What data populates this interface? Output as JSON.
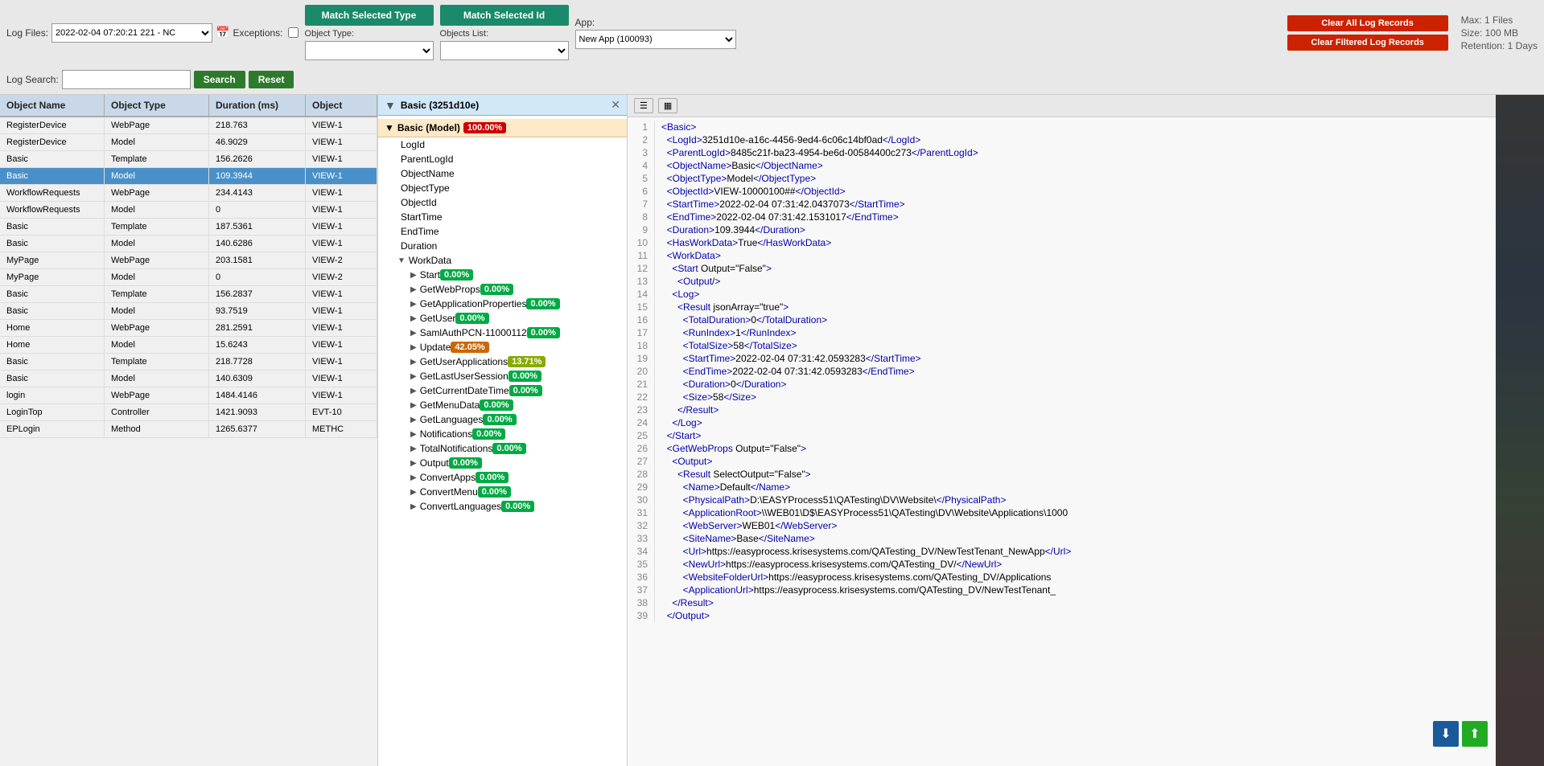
{
  "header": {
    "log_files_label": "Log Files:",
    "log_files_value": "2022-02-04 07:20:21 221 - NC",
    "exceptions_label": "Exceptions:",
    "log_search_label": "Log Search:",
    "search_placeholder": "",
    "search_btn": "Search",
    "reset_btn": "Reset",
    "match_type_btn": "Match Selected Type",
    "match_id_btn": "Match Selected Id",
    "object_type_label": "Object Type:",
    "objects_list_label": "Objects List:",
    "app_label": "App:",
    "app_value": "New App (100093)",
    "clear_all_btn": "Clear All Log Records",
    "clear_filtered_btn": "Clear Filtered Log Records",
    "meta_max": "Max: 1 Files",
    "meta_size": "Size: 100 MB",
    "meta_retention": "Retention: 1 Days"
  },
  "table": {
    "columns": [
      "Object Name",
      "Object Type",
      "Duration (ms)",
      "Object"
    ],
    "rows": [
      {
        "name": "RegisterDevice",
        "type": "WebPage",
        "duration": "218.763",
        "object": "VIEW-1"
      },
      {
        "name": "RegisterDevice",
        "type": "Model",
        "duration": "46.9029",
        "object": "VIEW-1"
      },
      {
        "name": "Basic",
        "type": "Template",
        "duration": "156.2626",
        "object": "VIEW-1"
      },
      {
        "name": "Basic",
        "type": "Model",
        "duration": "109.3944",
        "object": "VIEW-1",
        "selected": true
      },
      {
        "name": "WorkflowRequests",
        "type": "WebPage",
        "duration": "234.4143",
        "object": "VIEW-1"
      },
      {
        "name": "WorkflowRequests",
        "type": "Model",
        "duration": "0",
        "object": "VIEW-1"
      },
      {
        "name": "Basic",
        "type": "Template",
        "duration": "187.5361",
        "object": "VIEW-1"
      },
      {
        "name": "Basic",
        "type": "Model",
        "duration": "140.6286",
        "object": "VIEW-1"
      },
      {
        "name": "MyPage",
        "type": "WebPage",
        "duration": "203.1581",
        "object": "VIEW-2"
      },
      {
        "name": "MyPage",
        "type": "Model",
        "duration": "0",
        "object": "VIEW-2"
      },
      {
        "name": "Basic",
        "type": "Template",
        "duration": "156.2837",
        "object": "VIEW-1"
      },
      {
        "name": "Basic",
        "type": "Model",
        "duration": "93.7519",
        "object": "VIEW-1"
      },
      {
        "name": "Home",
        "type": "WebPage",
        "duration": "281.2591",
        "object": "VIEW-1"
      },
      {
        "name": "Home",
        "type": "Model",
        "duration": "15.6243",
        "object": "VIEW-1"
      },
      {
        "name": "Basic",
        "type": "Template",
        "duration": "218.7728",
        "object": "VIEW-1"
      },
      {
        "name": "Basic",
        "type": "Model",
        "duration": "140.6309",
        "object": "VIEW-1"
      },
      {
        "name": "login",
        "type": "WebPage",
        "duration": "1484.4146",
        "object": "VIEW-1"
      },
      {
        "name": "LoginTop",
        "type": "Controller",
        "duration": "1421.9093",
        "object": "EVT-10"
      },
      {
        "name": "EPLogin",
        "type": "Method",
        "duration": "1265.6377",
        "object": "METHC"
      }
    ]
  },
  "tree_panel": {
    "title": "Basic (3251d10e)",
    "root_label": "Basic (Model)",
    "root_pct": "100.00%",
    "items": [
      {
        "label": "LogId",
        "indent": 1,
        "expandable": false
      },
      {
        "label": "ParentLogId",
        "indent": 1,
        "expandable": false
      },
      {
        "label": "ObjectName",
        "indent": 1,
        "expandable": false
      },
      {
        "label": "ObjectType",
        "indent": 1,
        "expandable": false
      },
      {
        "label": "ObjectId",
        "indent": 1,
        "expandable": false
      },
      {
        "label": "StartTime",
        "indent": 1,
        "expandable": false
      },
      {
        "label": "EndTime",
        "indent": 1,
        "expandable": false
      },
      {
        "label": "Duration",
        "indent": 1,
        "expandable": false
      },
      {
        "label": "WorkData",
        "indent": 1,
        "expandable": true,
        "expanded": true
      },
      {
        "label": "Start",
        "indent": 2,
        "expandable": true,
        "expanded": false,
        "pct": "0.00%",
        "pct_class": "pct-0"
      },
      {
        "label": "GetWebProps",
        "indent": 2,
        "expandable": true,
        "expanded": false,
        "pct": "0.00%",
        "pct_class": "pct-0"
      },
      {
        "label": "GetApplicationProperties",
        "indent": 2,
        "expandable": true,
        "expanded": false,
        "pct": "0.00%",
        "pct_class": "pct-0"
      },
      {
        "label": "GetUser",
        "indent": 2,
        "expandable": true,
        "expanded": false,
        "pct": "0.00%",
        "pct_class": "pct-0"
      },
      {
        "label": "SamlAuthPCN-11000112",
        "indent": 2,
        "expandable": true,
        "expanded": false,
        "pct": "0.00%",
        "pct_class": "pct-0"
      },
      {
        "label": "Update",
        "indent": 2,
        "expandable": true,
        "expanded": false,
        "pct": "42.05%",
        "pct_class": "pct-42"
      },
      {
        "label": "GetUserApplications",
        "indent": 2,
        "expandable": true,
        "expanded": false,
        "pct": "13.71%",
        "pct_class": "pct-13"
      },
      {
        "label": "GetLastUserSession",
        "indent": 2,
        "expandable": true,
        "expanded": false,
        "pct": "0.00%",
        "pct_class": "pct-0"
      },
      {
        "label": "GetCurrentDateTime",
        "indent": 2,
        "expandable": true,
        "expanded": false,
        "pct": "0.00%",
        "pct_class": "pct-0"
      },
      {
        "label": "GetMenuData",
        "indent": 2,
        "expandable": true,
        "expanded": false,
        "pct": "0.00%",
        "pct_class": "pct-0"
      },
      {
        "label": "GetLanguages",
        "indent": 2,
        "expandable": true,
        "expanded": false,
        "pct": "0.00%",
        "pct_class": "pct-0"
      },
      {
        "label": "Notifications",
        "indent": 2,
        "expandable": true,
        "expanded": false,
        "pct": "0.00%",
        "pct_class": "pct-0"
      },
      {
        "label": "TotalNotifications",
        "indent": 2,
        "expandable": true,
        "expanded": false,
        "pct": "0.00%",
        "pct_class": "pct-0"
      },
      {
        "label": "Output",
        "indent": 2,
        "expandable": true,
        "expanded": false,
        "pct": "0.00%",
        "pct_class": "pct-0"
      },
      {
        "label": "ConvertApps",
        "indent": 2,
        "expandable": true,
        "expanded": false,
        "pct": "0.00%",
        "pct_class": "pct-0"
      },
      {
        "label": "ConvertMenu",
        "indent": 2,
        "expandable": true,
        "expanded": false,
        "pct": "0.00%",
        "pct_class": "pct-0"
      },
      {
        "label": "ConvertLanguages",
        "indent": 2,
        "expandable": true,
        "expanded": false,
        "pct": "0.00%",
        "pct_class": "pct-0"
      }
    ]
  },
  "xml_panel": {
    "lines": [
      {
        "num": 1,
        "content": "<Basic>"
      },
      {
        "num": 2,
        "content": "  <LogId>3251d10e-a16c-4456-9ed4-6c06c14bf0ad</LogId>"
      },
      {
        "num": 3,
        "content": "  <ParentLogId>8485c21f-ba23-4954-be6d-00584400c273</ParentLogId>"
      },
      {
        "num": 4,
        "content": "  <ObjectName>Basic</ObjectName>"
      },
      {
        "num": 5,
        "content": "  <ObjectType>Model</ObjectType>"
      },
      {
        "num": 6,
        "content": "  <ObjectId>VIEW-10000100##</ObjectId>"
      },
      {
        "num": 7,
        "content": "  <StartTime>2022-02-04 07:31:42.0437073</StartTime>"
      },
      {
        "num": 8,
        "content": "  <EndTime>2022-02-04 07:31:42.1531017</EndTime>"
      },
      {
        "num": 9,
        "content": "  <Duration>109.3944</Duration>"
      },
      {
        "num": 10,
        "content": "  <HasWorkData>True</HasWorkData>"
      },
      {
        "num": 11,
        "content": "  <WorkData>"
      },
      {
        "num": 12,
        "content": "    <Start Output=\"False\">"
      },
      {
        "num": 13,
        "content": "      <Output/>"
      },
      {
        "num": 14,
        "content": "    <Log>"
      },
      {
        "num": 15,
        "content": "      <Result jsonArray=\"true\">"
      },
      {
        "num": 16,
        "content": "        <TotalDuration>0</TotalDuration>"
      },
      {
        "num": 17,
        "content": "        <RunIndex>1</RunIndex>"
      },
      {
        "num": 18,
        "content": "        <TotalSize>58</TotalSize>"
      },
      {
        "num": 19,
        "content": "        <StartTime>2022-02-04 07:31:42.0593283</StartTime>"
      },
      {
        "num": 20,
        "content": "        <EndTime>2022-02-04 07:31:42.0593283</EndTime>"
      },
      {
        "num": 21,
        "content": "        <Duration>0</Duration>"
      },
      {
        "num": 22,
        "content": "        <Size>58</Size>"
      },
      {
        "num": 23,
        "content": "      </Result>"
      },
      {
        "num": 24,
        "content": "    </Log>"
      },
      {
        "num": 25,
        "content": "  </Start>"
      },
      {
        "num": 26,
        "content": "  <GetWebProps Output=\"False\">"
      },
      {
        "num": 27,
        "content": "    <Output>"
      },
      {
        "num": 28,
        "content": "      <Result SelectOutput=\"False\">"
      },
      {
        "num": 29,
        "content": "        <Name>Default</Name>"
      },
      {
        "num": 30,
        "content": "        <PhysicalPath>D:\\EASYProcess51\\QATesting\\DV\\Website\\</PhysicalPath>"
      },
      {
        "num": 31,
        "content": "        <ApplicationRoot>\\\\WEB01\\D$\\EASYProcess51\\QATesting\\DV\\Website\\Applications\\1000"
      },
      {
        "num": 32,
        "content": "        <WebServer>WEB01</WebServer>"
      },
      {
        "num": 33,
        "content": "        <SiteName>Base</SiteName>"
      },
      {
        "num": 34,
        "content": "        <Url>https://easyprocess.krisesystems.com/QATesting_DV/NewTestTenant_NewApp</Url>"
      },
      {
        "num": 35,
        "content": "        <NewUrl>https://easyprocess.krisesystems.com/QATesting_DV/</NewUrl>"
      },
      {
        "num": 36,
        "content": "        <WebsiteFolderUrl>https://easyprocess.krisesystems.com/QATesting_DV/Applications"
      },
      {
        "num": 37,
        "content": "        <ApplicationUrl>https://easyprocess.krisesystems.com/QATesting_DV/NewTestTenant_"
      },
      {
        "num": 38,
        "content": "    </Result>"
      },
      {
        "num": 39,
        "content": "  </Output>"
      }
    ]
  },
  "bottom_actions": {
    "download_label": "⬇",
    "upload_label": "⬆"
  }
}
